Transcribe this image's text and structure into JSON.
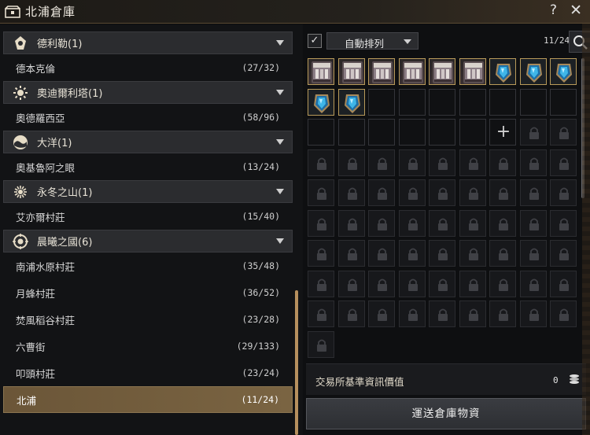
{
  "window": {
    "title": "北浦倉庫",
    "help_label": "?",
    "close_label": "✕"
  },
  "regions": [
    {
      "label": "德利勒(1)",
      "icon": "crest-icon",
      "towns": [
        {
          "name": "德本克倫",
          "count": "(27/32)"
        }
      ]
    },
    {
      "label": "奧迪爾利塔(1)",
      "icon": "sunburst-icon",
      "towns": [
        {
          "name": "奧德羅西亞",
          "count": "(58/96)"
        }
      ]
    },
    {
      "label": "大洋(1)",
      "icon": "wave-icon",
      "towns": [
        {
          "name": "奧基魯阿之眼",
          "count": "(13/24)"
        }
      ]
    },
    {
      "label": "永冬之山(1)",
      "icon": "snowflake-icon",
      "towns": [
        {
          "name": "艾亦爾村莊",
          "count": "(15/40)"
        }
      ]
    },
    {
      "label": "晨曦之國(6)",
      "icon": "dawn-emblem-icon",
      "towns": [
        {
          "name": "南浦水原村莊",
          "count": "(35/48)"
        },
        {
          "name": "月蜂村莊",
          "count": "(36/52)"
        },
        {
          "name": "焚風稻谷村莊",
          "count": "(23/28)"
        },
        {
          "name": "六曹街",
          "count": "(29/133)"
        },
        {
          "name": "叩頭村莊",
          "count": "(23/24)"
        },
        {
          "name": "北浦",
          "count": "(11/24)",
          "selected": true
        }
      ]
    }
  ],
  "storage": {
    "auto_sort_checked": "✓",
    "auto_sort_label": "自動排列",
    "capacity": "11/24",
    "add_slot_symbol": "+",
    "items": [
      "weapon-box-icon",
      "weapon-box-icon",
      "weapon-box-icon",
      "weapon-box-icon",
      "weapon-box-icon",
      "weapon-box-icon",
      "blue-crystal-icon",
      "blue-crystal-icon",
      "blue-crystal-icon",
      "blue-crystal-icon",
      "blue-crystal-icon"
    ],
    "unlocked_empty": 13,
    "locked_total": 57,
    "market_value_label": "交易所基準資訊價值",
    "market_value": "0",
    "transport_button": "運送倉庫物資"
  },
  "colors": {
    "selected_row": "#6b5638",
    "item_border": "#b89a5a",
    "gem_blue": "#3fb6e8"
  }
}
